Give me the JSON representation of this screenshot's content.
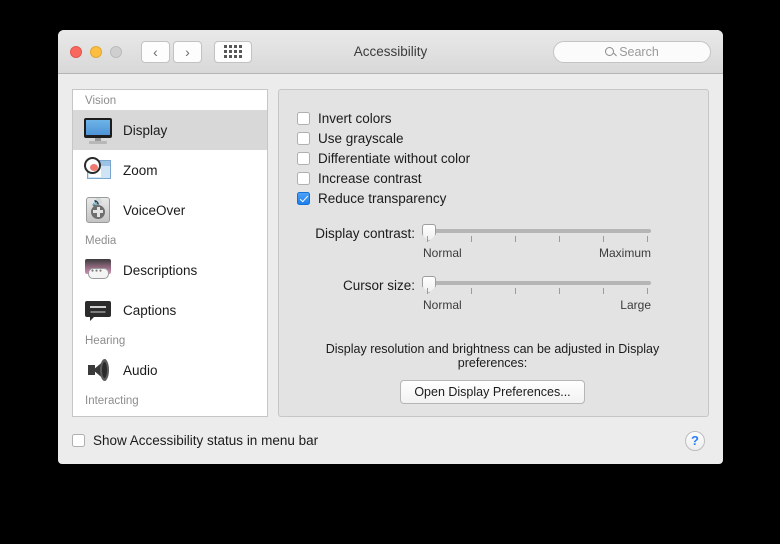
{
  "window": {
    "title": "Accessibility",
    "traffic_lights": [
      "close",
      "minimize",
      "zoom"
    ],
    "nav": {
      "back": "‹",
      "forward": "›",
      "grid": "all-preferences"
    },
    "search": {
      "placeholder": "Search",
      "value": ""
    }
  },
  "sidebar": {
    "groups": [
      {
        "header": "Vision",
        "items": [
          {
            "label": "Display",
            "icon": "display-icon",
            "selected": true
          },
          {
            "label": "Zoom",
            "icon": "zoom-icon",
            "selected": false
          },
          {
            "label": "VoiceOver",
            "icon": "voiceover-icon",
            "selected": false
          }
        ]
      },
      {
        "header": "Media",
        "items": [
          {
            "label": "Descriptions",
            "icon": "descriptions-icon",
            "selected": false
          },
          {
            "label": "Captions",
            "icon": "captions-icon",
            "selected": false
          }
        ]
      },
      {
        "header": "Hearing",
        "items": [
          {
            "label": "Audio",
            "icon": "audio-icon",
            "selected": false
          }
        ]
      },
      {
        "header": "Interacting",
        "items": []
      }
    ]
  },
  "panel": {
    "checkboxes": [
      {
        "label": "Invert colors",
        "checked": false
      },
      {
        "label": "Use grayscale",
        "checked": false
      },
      {
        "label": "Differentiate without color",
        "checked": false
      },
      {
        "label": "Increase contrast",
        "checked": false
      },
      {
        "label": "Reduce transparency",
        "checked": true
      }
    ],
    "sliders": [
      {
        "label": "Display contrast:",
        "min_label": "Normal",
        "max_label": "Maximum",
        "value_percent": 0,
        "tick_count": 6
      },
      {
        "label": "Cursor size:",
        "min_label": "Normal",
        "max_label": "Large",
        "value_percent": 0,
        "tick_count": 6
      }
    ],
    "note": "Display resolution and brightness can be adjusted in Display preferences:",
    "button": "Open Display Preferences..."
  },
  "footer": {
    "status_checkbox": {
      "label": "Show Accessibility status in menu bar",
      "checked": false
    },
    "help": "?"
  },
  "colors": {
    "accent": "#1c7fee",
    "help_blue": "#2b7ff5",
    "selected_row": "#d8d8d8",
    "panel_bg": "#e3e3e3"
  }
}
